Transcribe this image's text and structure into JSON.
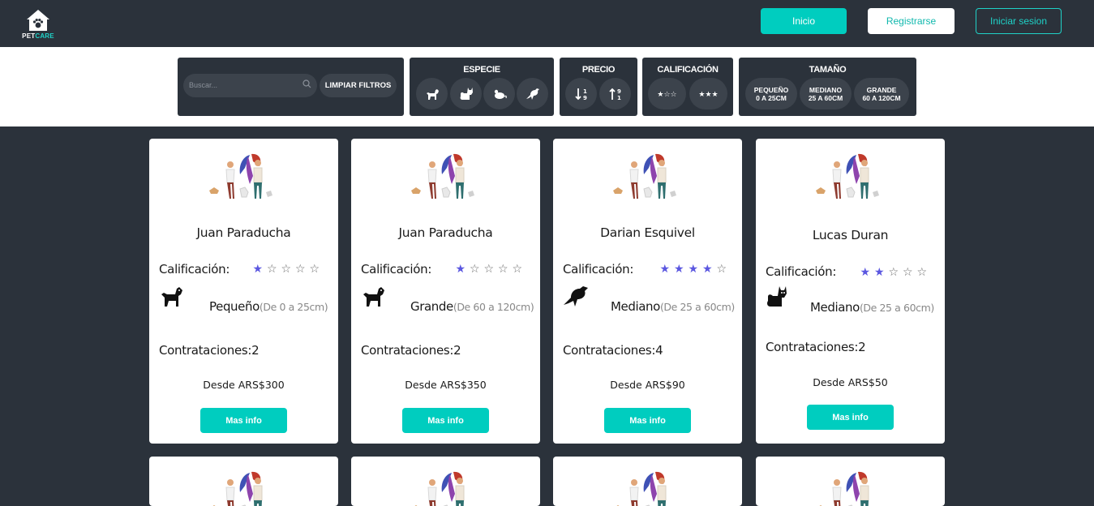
{
  "header": {
    "logo_text_a": "PET",
    "logo_text_b": "CARE",
    "nav": {
      "home_label": "Inicio",
      "register_label": "Registrarse",
      "login_label": "Iniciar sesion"
    }
  },
  "filters": {
    "search_placeholder": "Buscar...",
    "clear_label": "LIMPIAR FILTROS",
    "species_title": "ESPECIE",
    "species_icons": [
      "dog-icon",
      "cat-icon",
      "rodent-icon",
      "bird-icon"
    ],
    "price_title": "PRECIO",
    "price_icons": [
      "sort-ascending-icon",
      "sort-descending-icon"
    ],
    "rating_title": "CALIFICACIÓN",
    "rating_options": [
      "★☆☆",
      "★★★"
    ],
    "size_title": "TAMAÑO",
    "size_options": [
      {
        "name": "PEQUEÑO",
        "range": "0 A 25CM"
      },
      {
        "name": "MEDIANO",
        "range": "25 A 60CM"
      },
      {
        "name": "GRANDE",
        "range": "60 A 120CM"
      }
    ]
  },
  "cards": [
    {
      "name": "Juan Paraducha",
      "rating_label": "Calificación:",
      "rating": 1,
      "pet": "dog-icon",
      "size": "Pequeño",
      "size_range": "(De 0 a 25cm)",
      "contrataciones_label": "Contrataciones:",
      "contrataciones": "2",
      "price": "Desde ARS$300",
      "button": "Mas info"
    },
    {
      "name": "Juan Paraducha",
      "rating_label": "Calificación:",
      "rating": 1,
      "pet": "dog-icon",
      "size": "Grande",
      "size_range": "(De 60 a 120cm)",
      "contrataciones_label": "Contrataciones:",
      "contrataciones": "2",
      "price": "Desde ARS$350",
      "button": "Mas info"
    },
    {
      "name": "Darian Esquivel",
      "rating_label": "Calificación:",
      "rating": 4,
      "pet": "bird-icon",
      "size": "Mediano",
      "size_range": "(De 25 a 60cm)",
      "contrataciones_label": "Contrataciones:",
      "contrataciones": "4",
      "price": "Desde ARS$90",
      "button": "Mas info"
    },
    {
      "name": "Lucas Duran",
      "rating_label": "Calificación:",
      "rating": 2,
      "pet": "cat-icon",
      "size": "Mediano",
      "size_range": "(De 25 a 60cm)",
      "contrataciones_label": "Contrataciones:",
      "contrataciones": "2",
      "price": "Desde ARS$50",
      "button": "Mas info"
    }
  ],
  "colors": {
    "accent": "#00cdbf",
    "dark": "#2b323b",
    "star": "#5b57e0"
  }
}
